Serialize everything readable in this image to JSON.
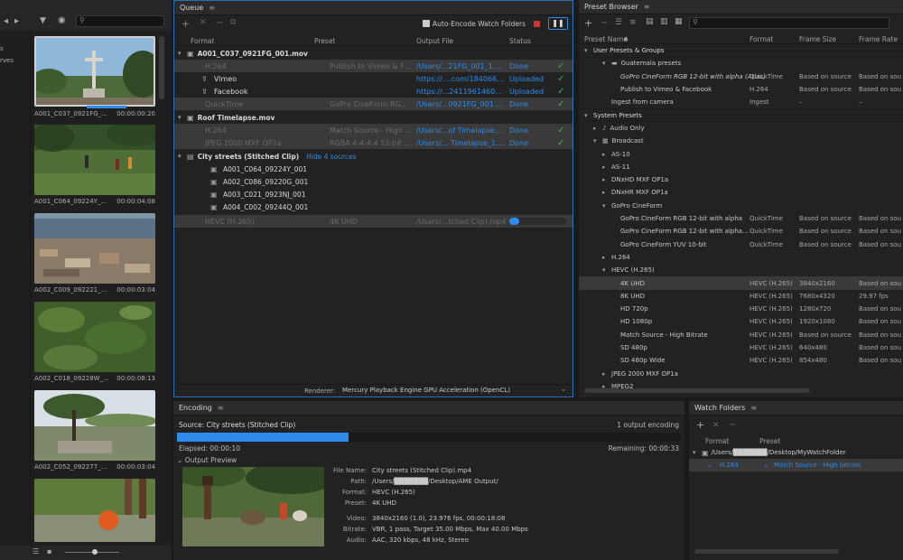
{
  "media": {
    "items": [
      {
        "name": "A001_C037_0921FG_...",
        "duration": "00:00:00:20"
      },
      {
        "name": "A001_C064_09224Y_...",
        "duration": "00:00:04:08"
      },
      {
        "name": "A002_C009_092221_...",
        "duration": "00:00:03:04"
      },
      {
        "name": "A002_C018_09228W_...",
        "duration": "00:00:08:13"
      },
      {
        "name": "A002_C052_092277_...",
        "duration": "00:00:03:04"
      }
    ],
    "left_edge_labels": [
      "s",
      "rves"
    ]
  },
  "queue": {
    "title": "Queue",
    "auto_encode_label": "Auto-Encode Watch Folders",
    "columns": {
      "format": "Format",
      "preset": "Preset",
      "output": "Output File",
      "status": "Status"
    },
    "groups": [
      {
        "name": "A001_C037_0921FG_001.mov",
        "rows": [
          {
            "format": "H.264",
            "preset": "Publish to Vimeo & Face...",
            "output": "/Users/...21FG_001_1.mp4",
            "status": "Done",
            "check": true
          },
          {
            "format": "Vimeo",
            "preset": "",
            "output": "https://....com/184066142",
            "status": "Uploaded",
            "check": true
          },
          {
            "format": "Facebook",
            "preset": "",
            "output": "https://...24119614602283",
            "status": "Uploaded",
            "check": true
          },
          {
            "format": "QuickTime",
            "preset": "GoPro CineForm RGB 12...",
            "output": "/Users/...0921FG_001.mov",
            "status": "Done",
            "check": true
          }
        ]
      },
      {
        "name": "Roof Timelapse.mov",
        "rows": [
          {
            "format": "H.264",
            "preset": "Match Source - High bitra...",
            "output": "/Users/...of Timelapse.mp4",
            "status": "Done",
            "check": true
          },
          {
            "format": "JPEG 2000 MXF OP1a",
            "preset": "RGBA 4:4:4:4 12-bit (BC...",
            "output": "/Users/... Timelapse_1.mxf",
            "status": "Done",
            "check": true
          }
        ]
      }
    ],
    "stitched": {
      "name": "City streets (Stitched Clip)",
      "hide_label": "Hide 4 sources",
      "sources": [
        "A001_C064_09224Y_001",
        "A002_C086_09220G_001",
        "A003_C021_0923NJ_001",
        "A004_C002_09244Q_001"
      ],
      "row": {
        "format": "HEVC (H.265)",
        "preset": "4K UHD",
        "output": "/Users/...tched Clip).mp4",
        "progress": 0.17
      }
    },
    "renderer_label": "Renderer:",
    "renderer_value": "Mercury Playback Engine GPU Acceleration (OpenCL)"
  },
  "encoding": {
    "title": "Encoding",
    "source": "Source: City streets (Stitched Clip)",
    "count": "1 output encoding",
    "progress": 0.34,
    "elapsed": "Elapsed: 00:00:10",
    "remaining": "Remaining: 00:00:33",
    "output_preview": "Output Preview",
    "info": [
      {
        "label": "File Name:",
        "value": "City streets (Stitched Clip).mp4"
      },
      {
        "label": "Path:",
        "value": "/Users/███████/Desktop/AME Output/"
      },
      {
        "label": "Format:",
        "value": "HEVC (H.265)"
      },
      {
        "label": "Preset:",
        "value": "4K UHD"
      },
      {
        "label": "Video:",
        "value": "3840x2160 (1.0), 23.976 fps, 00:00:18:08"
      },
      {
        "label": "Bitrate:",
        "value": "VBR, 1 pass, Target 35.00 Mbps, Max 40.00 Mbps"
      },
      {
        "label": "Audio:",
        "value": "AAC, 320 kbps, 48 kHz, Stereo"
      }
    ]
  },
  "preset_browser": {
    "title": "Preset Browser",
    "columns": {
      "name": "Preset Name",
      "format": "Format",
      "frame_size": "Frame Size",
      "frame_rate": "Frame Rate"
    },
    "rows": [
      {
        "indent": 0,
        "tri": "down",
        "icon": "",
        "name": "User Presets & Groups",
        "format": "",
        "size": "",
        "rate": "",
        "header": true
      },
      {
        "indent": 2,
        "tri": "down",
        "icon": "folder",
        "name": "Guatemala presets",
        "format": "",
        "size": "",
        "rate": ""
      },
      {
        "indent": 3,
        "tri": "",
        "icon": "",
        "name": "GoPro CineForm RGB 12-bit with alpha (Atlas)",
        "format": "QuickTime",
        "size": "Based on source",
        "rate": "Based on sou",
        "italic": true
      },
      {
        "indent": 3,
        "tri": "",
        "icon": "",
        "name": "Publish to Vimeo & Facebook",
        "format": "H.264",
        "size": "Based on source",
        "rate": "Based on sou"
      },
      {
        "indent": 2,
        "tri": "",
        "icon": "",
        "name": "Ingest from camera",
        "format": "Ingest",
        "size": "–",
        "rate": "–"
      },
      {
        "indent": 0,
        "tri": "down",
        "icon": "",
        "name": "System Presets",
        "format": "",
        "size": "",
        "rate": "",
        "header": true
      },
      {
        "indent": 1,
        "tri": "right",
        "icon": "audio",
        "name": "Audio Only",
        "format": "",
        "size": "",
        "rate": ""
      },
      {
        "indent": 1,
        "tri": "down",
        "icon": "broadcast",
        "name": "Broadcast",
        "format": "",
        "size": "",
        "rate": ""
      },
      {
        "indent": 2,
        "tri": "right",
        "icon": "",
        "name": "AS-10",
        "format": "",
        "size": "",
        "rate": ""
      },
      {
        "indent": 2,
        "tri": "right",
        "icon": "",
        "name": "AS-11",
        "format": "",
        "size": "",
        "rate": ""
      },
      {
        "indent": 2,
        "tri": "right",
        "icon": "",
        "name": "DNxHD MXF OP1a",
        "format": "",
        "size": "",
        "rate": ""
      },
      {
        "indent": 2,
        "tri": "right",
        "icon": "",
        "name": "DNxHR MXF OP1a",
        "format": "",
        "size": "",
        "rate": ""
      },
      {
        "indent": 2,
        "tri": "down",
        "icon": "",
        "name": "GoPro CineForm",
        "format": "",
        "size": "",
        "rate": ""
      },
      {
        "indent": 3,
        "tri": "",
        "icon": "",
        "name": "GoPro CineForm RGB 12-bit with alpha",
        "format": "QuickTime",
        "size": "Based on source",
        "rate": "Based on sou"
      },
      {
        "indent": 3,
        "tri": "",
        "icon": "",
        "name": "GoPro CineForm RGB 12-bit with alpha...",
        "format": "QuickTime",
        "size": "Based on source",
        "rate": "Based on sou"
      },
      {
        "indent": 3,
        "tri": "",
        "icon": "",
        "name": "GoPro CineForm YUV 10-bit",
        "format": "QuickTime",
        "size": "Based on source",
        "rate": "Based on sou"
      },
      {
        "indent": 2,
        "tri": "right",
        "icon": "",
        "name": "H.264",
        "format": "",
        "size": "",
        "rate": ""
      },
      {
        "indent": 2,
        "tri": "down",
        "icon": "",
        "name": "HEVC (H.265)",
        "format": "",
        "size": "",
        "rate": ""
      },
      {
        "indent": 3,
        "tri": "",
        "icon": "",
        "name": "4K UHD",
        "format": "HEVC (H.265)",
        "size": "3840x2160",
        "rate": "Based on sou",
        "selected": true
      },
      {
        "indent": 3,
        "tri": "",
        "icon": "",
        "name": "8K UHD",
        "format": "HEVC (H.265)",
        "size": "7680x4320",
        "rate": "29.97 fps"
      },
      {
        "indent": 3,
        "tri": "",
        "icon": "",
        "name": "HD 720p",
        "format": "HEVC (H.265)",
        "size": "1280x720",
        "rate": "Based on sou"
      },
      {
        "indent": 3,
        "tri": "",
        "icon": "",
        "name": "HD 1080p",
        "format": "HEVC (H.265)",
        "size": "1920x1080",
        "rate": "Based on sou"
      },
      {
        "indent": 3,
        "tri": "",
        "icon": "",
        "name": "Match Source - High Bitrate",
        "format": "HEVC (H.265)",
        "size": "Based on source",
        "rate": "Based on sou"
      },
      {
        "indent": 3,
        "tri": "",
        "icon": "",
        "name": "SD 480p",
        "format": "HEVC (H.265)",
        "size": "640x480",
        "rate": "Based on sou"
      },
      {
        "indent": 3,
        "tri": "",
        "icon": "",
        "name": "SD 480p Wide",
        "format": "HEVC (H.265)",
        "size": "854x480",
        "rate": "Based on sou"
      },
      {
        "indent": 2,
        "tri": "right",
        "icon": "",
        "name": "JPEG 2000 MXF OP1a",
        "format": "",
        "size": "",
        "rate": ""
      },
      {
        "indent": 2,
        "tri": "right",
        "icon": "",
        "name": "MPEG2",
        "format": "",
        "size": "",
        "rate": ""
      }
    ]
  },
  "watch_folders": {
    "title": "Watch Folders",
    "col_format": "Format",
    "col_preset": "Preset",
    "folder": "/Users/███████/Desktop/MyWatchFolder",
    "format": "H.264",
    "preset": "Match Source - High bitrate"
  },
  "colors": {
    "accent": "#2d8ceb",
    "done": "#36b34a",
    "stop": "#d8312a"
  }
}
